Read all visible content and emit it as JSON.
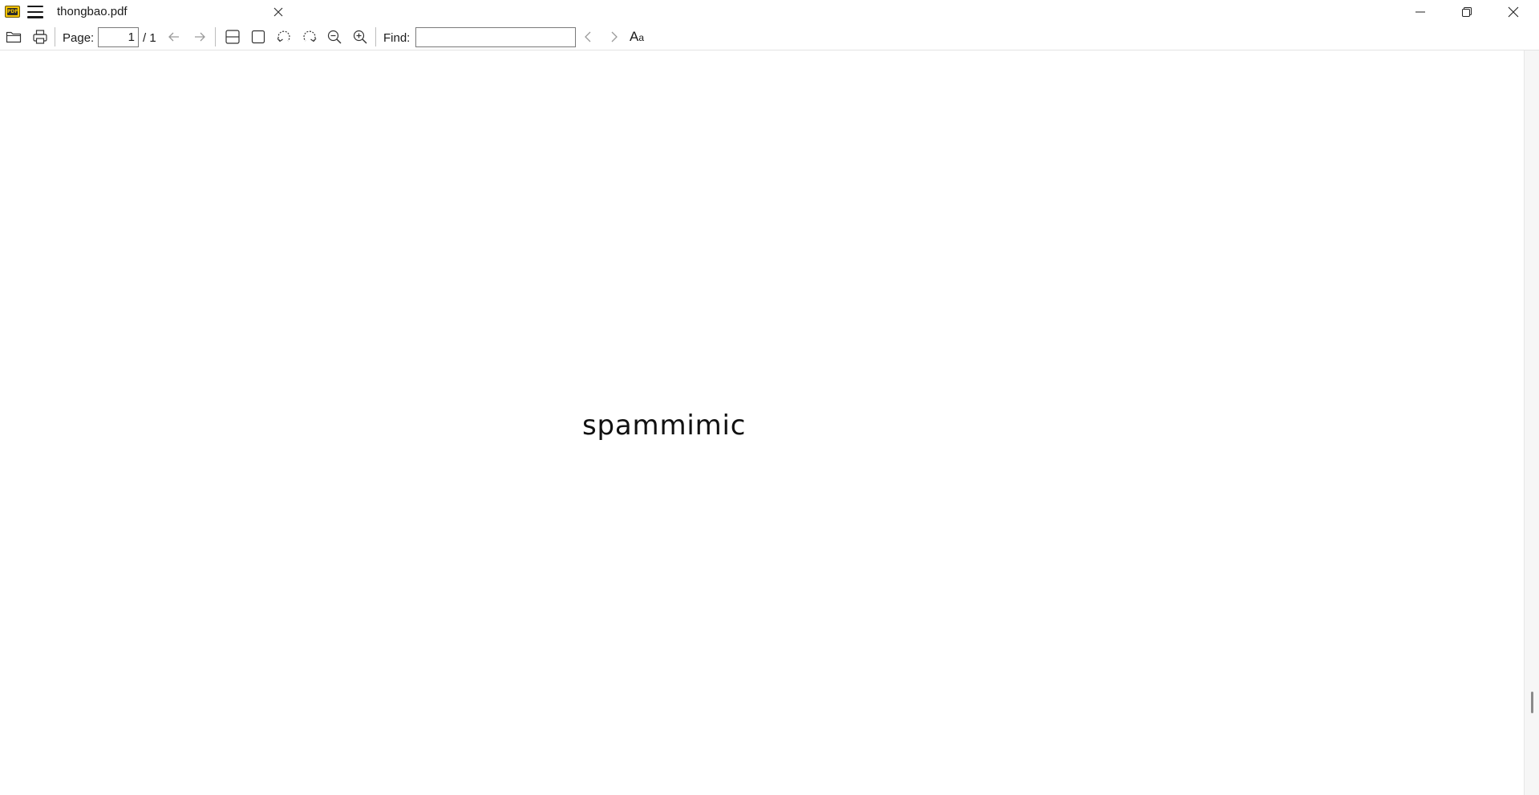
{
  "window": {
    "file_name": "thongbao.pdf",
    "app_icon_text": "PDF"
  },
  "toolbar": {
    "page_label": "Page:",
    "page_current": "1",
    "page_total": "/ 1",
    "find_label": "Find:",
    "find_value": "",
    "match_case_label_big": "A",
    "match_case_label_small": "a",
    "icons": [
      "open-icon",
      "print-icon",
      "previous-page-icon",
      "next-page-icon",
      "fit-width-icon",
      "fit-page-icon",
      "rotate-left-icon",
      "rotate-right-icon",
      "zoom-out-icon",
      "zoom-in-icon",
      "find-previous-icon",
      "find-next-icon",
      "match-case-icon"
    ]
  },
  "document": {
    "text": "spammimic"
  },
  "colors": {
    "background": "#ffffff",
    "app_icon": "#f5c400"
  }
}
